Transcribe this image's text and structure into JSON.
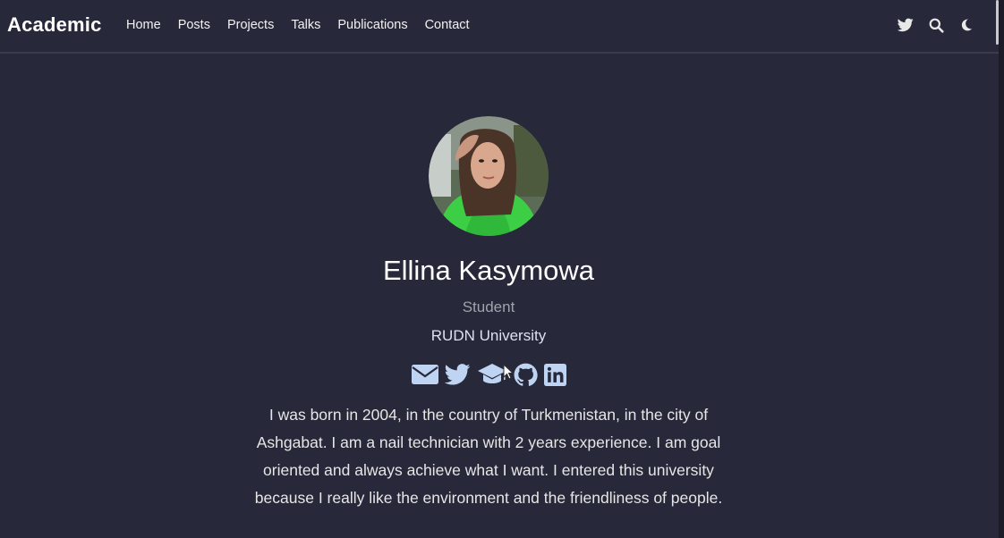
{
  "navbar": {
    "brand": "Academic",
    "links": [
      "Home",
      "Posts",
      "Projects",
      "Talks",
      "Publications",
      "Contact"
    ],
    "icons": [
      "twitter-icon",
      "search-icon",
      "moon-icon"
    ]
  },
  "profile": {
    "name": "Ellina Kasymowa",
    "role": "Student",
    "organization": "RUDN University",
    "social_icons": [
      "envelope-icon",
      "twitter-icon",
      "graduation-cap-icon",
      "github-icon",
      "linkedin-icon"
    ],
    "bio": "I was born in 2004, in the country of Turkmenistan, in the city of Ashgabat. I am a nail technician with 2 years experience. I am goal oriented and always achieve what I want. I entered this university because I really like the environment and the friendliness of people."
  },
  "colors": {
    "background": "#272839",
    "icon_accent": "#bfd4f2",
    "text": "#e6e6e6"
  }
}
